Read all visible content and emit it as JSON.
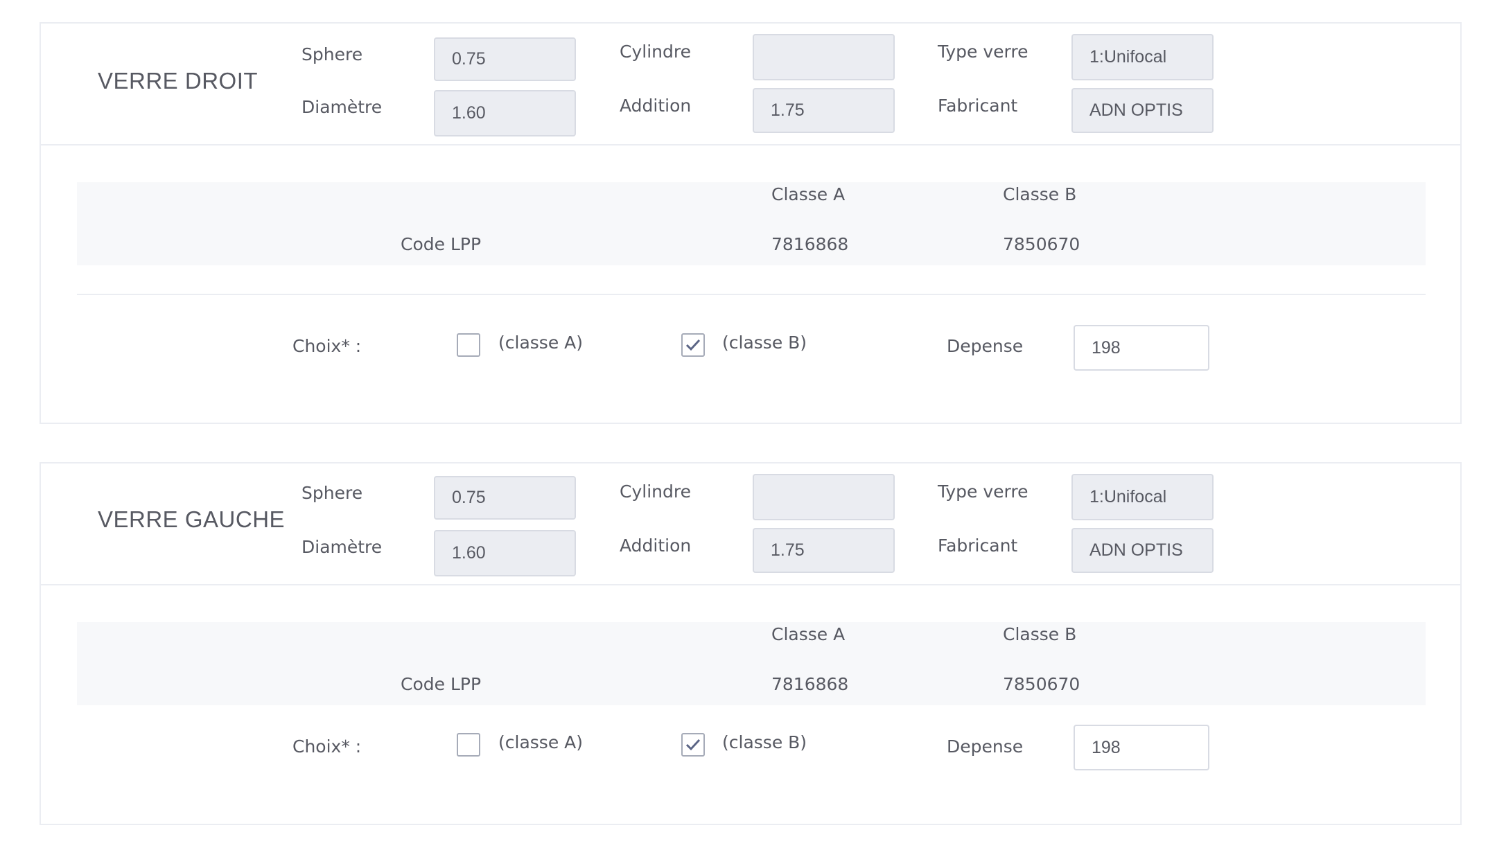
{
  "labels": {
    "sphere": "Sphere",
    "cylindre": "Cylindre",
    "type_verre": "Type verre",
    "diametre": "Diamètre",
    "addition": "Addition",
    "fabricant": "Fabricant",
    "classe_a": "Classe A",
    "classe_b": "Classe B",
    "code_lpp": "Code LPP",
    "choix": "Choix* :",
    "option_a": "(classe A)",
    "option_b": "(classe B)",
    "depense": "Depense"
  },
  "right": {
    "title": "VERRE DROIT",
    "sphere": "0.75",
    "cylindre": "",
    "type_verre": "1:Unifocal",
    "diametre": "1.60",
    "addition": "1.75",
    "fabricant": "ADN OPTIS",
    "lpp_classe_a": "7816868",
    "lpp_classe_b": "7850670",
    "choice_a_checked": false,
    "choice_b_checked": true,
    "depense": "198"
  },
  "left": {
    "title": "VERRE GAUCHE",
    "sphere": "0.75",
    "cylindre": "",
    "type_verre": "1:Unifocal",
    "diametre": "1.60",
    "addition": "1.75",
    "fabricant": "ADN OPTIS",
    "lpp_classe_a": "7816868",
    "lpp_classe_b": "7850670",
    "choice_a_checked": false,
    "choice_b_checked": true,
    "depense": "198"
  },
  "colors": {
    "text": "#575962",
    "readonly_bg": "#ebedf2",
    "border": "#d8dbe3",
    "check": "#5b6585"
  }
}
